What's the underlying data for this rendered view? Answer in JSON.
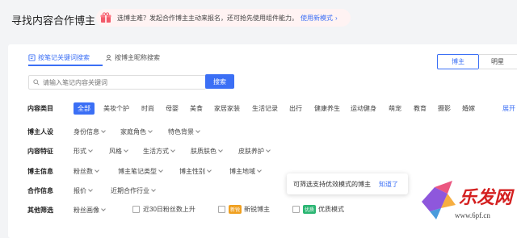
{
  "header": {
    "title": "寻找内容合作博主",
    "promo_text": "选博主难？发起合作博主主动来报名，还可抢先使用组件能力。",
    "promo_link": "使用新模式",
    "promo_arrow": "›"
  },
  "tabs": [
    {
      "label": "按笔记关键词搜索",
      "active": true
    },
    {
      "label": "按博主昵称搜索",
      "active": false
    }
  ],
  "toggle": [
    "博主",
    "明星"
  ],
  "search": {
    "placeholder": "请输入笔记内容关键词",
    "button": "搜索"
  },
  "categories": {
    "label": "内容类目",
    "items": [
      "全部",
      "美妆个护",
      "时尚",
      "母婴",
      "美食",
      "家居家装",
      "生活记录",
      "出行",
      "健康养生",
      "运动健身",
      "萌宠",
      "教育",
      "摄影",
      "婚嫁"
    ],
    "expand": "展开"
  },
  "persona": {
    "label": "博主人设",
    "filters": [
      "身份信息",
      "家庭角色",
      "特色背景"
    ]
  },
  "content_features": {
    "label": "内容特征",
    "filters": [
      "形式",
      "风格",
      "生活方式",
      "肤质肤色",
      "皮肤养护"
    ]
  },
  "blogger_info": {
    "label": "博主信息",
    "filters": [
      "粉丝数",
      "博主笔记类型",
      "博主性别",
      "博主地域"
    ]
  },
  "cooperation": {
    "label": "合作信息",
    "filters": [
      "报价",
      "近期合作行业"
    ]
  },
  "other": {
    "label": "其他筛选",
    "filters": [
      "粉丝画像"
    ],
    "checks": [
      {
        "label": "近30日粉丝数上升"
      },
      {
        "badge": "新锐",
        "label": "新锐博主",
        "badge_color": "#f0a020"
      },
      {
        "badge": "优质",
        "label": "优质模式",
        "badge_color": "#2bb673"
      }
    ]
  },
  "tooltip": {
    "text": "可筛选支持优效模式的博主",
    "link": "知道了"
  },
  "watermark": {
    "brand": "乐发网",
    "site": "www.6pf.cn"
  },
  "colors": {
    "accent": "#3b6ff5",
    "promo_bg": "#fff3f3",
    "watermark_red": "#d42020"
  }
}
